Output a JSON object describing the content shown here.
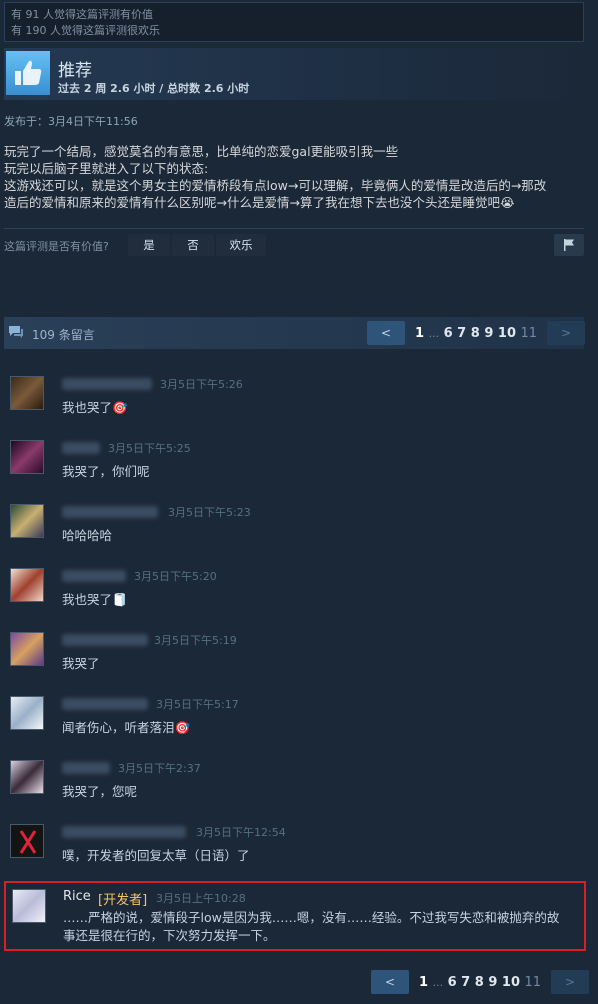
{
  "helpful": {
    "line1": "有 91 人觉得这篇评测有价值",
    "line2": "有 190 人觉得这篇评测很欢乐"
  },
  "recommendation": {
    "title": "推荐",
    "hours": "过去 2 周 2.6 小时 / 总时数 2.6 小时",
    "posted": "发布于：3月4日下午11:56"
  },
  "review": {
    "lines": [
      "玩完了一个结局，感觉莫名的有意思，比单纯的恋爱gal更能吸引我一些",
      "玩完以后脑子里就进入了以下的状态:",
      "这游戏还可以，就是这个男女主的爱情桥段有点low→可以理解，毕竟俩人的爱情是改造后的→那改",
      "造后的爱情和原来的爱情有什么区别呢→什么是爱情→算了我在想下去也没个头还是睡觉吧😭"
    ]
  },
  "vote": {
    "question": "这篇评测是否有价值?",
    "yes": "是",
    "no": "否",
    "funny": "欢乐",
    "flag_icon": "flag-icon"
  },
  "comments_header": {
    "count": "109 条留言",
    "icon": "comment-bubble-icon"
  },
  "pager": {
    "prev": "<",
    "next": ">",
    "first": "1",
    "ellipsis": "...",
    "pages": "6 7 8 9 10",
    "last": "11"
  },
  "comments": [
    {
      "time": "3月5日下午5:26",
      "text": "我也哭了🎯"
    },
    {
      "time": "3月5日下午5:25",
      "text": "我哭了，你们呢"
    },
    {
      "time": "3月5日下午5:23",
      "text": "哈哈哈哈"
    },
    {
      "time": "3月5日下午5:20",
      "text": "我也哭了🧻"
    },
    {
      "time": "3月5日下午5:19",
      "text": "我哭了"
    },
    {
      "time": "3月5日下午5:17",
      "text": "闻者伤心，听者落泪🎯"
    },
    {
      "time": "3月5日下午2:37",
      "text": "我哭了，您呢"
    },
    {
      "time": "3月5日下午12:54",
      "text": "噗，开发者的回复太草（日语）了"
    }
  ],
  "developer_comment": {
    "name": "Rice",
    "tag": "[开发者]",
    "time": "3月5日上午10:28",
    "line1": "……严格的说，爱情段子low是因为我……嗯，没有……经验。不过我写失恋和被抛弃的故",
    "line2": "事还是很在行的，下次努力发挥一下。"
  }
}
